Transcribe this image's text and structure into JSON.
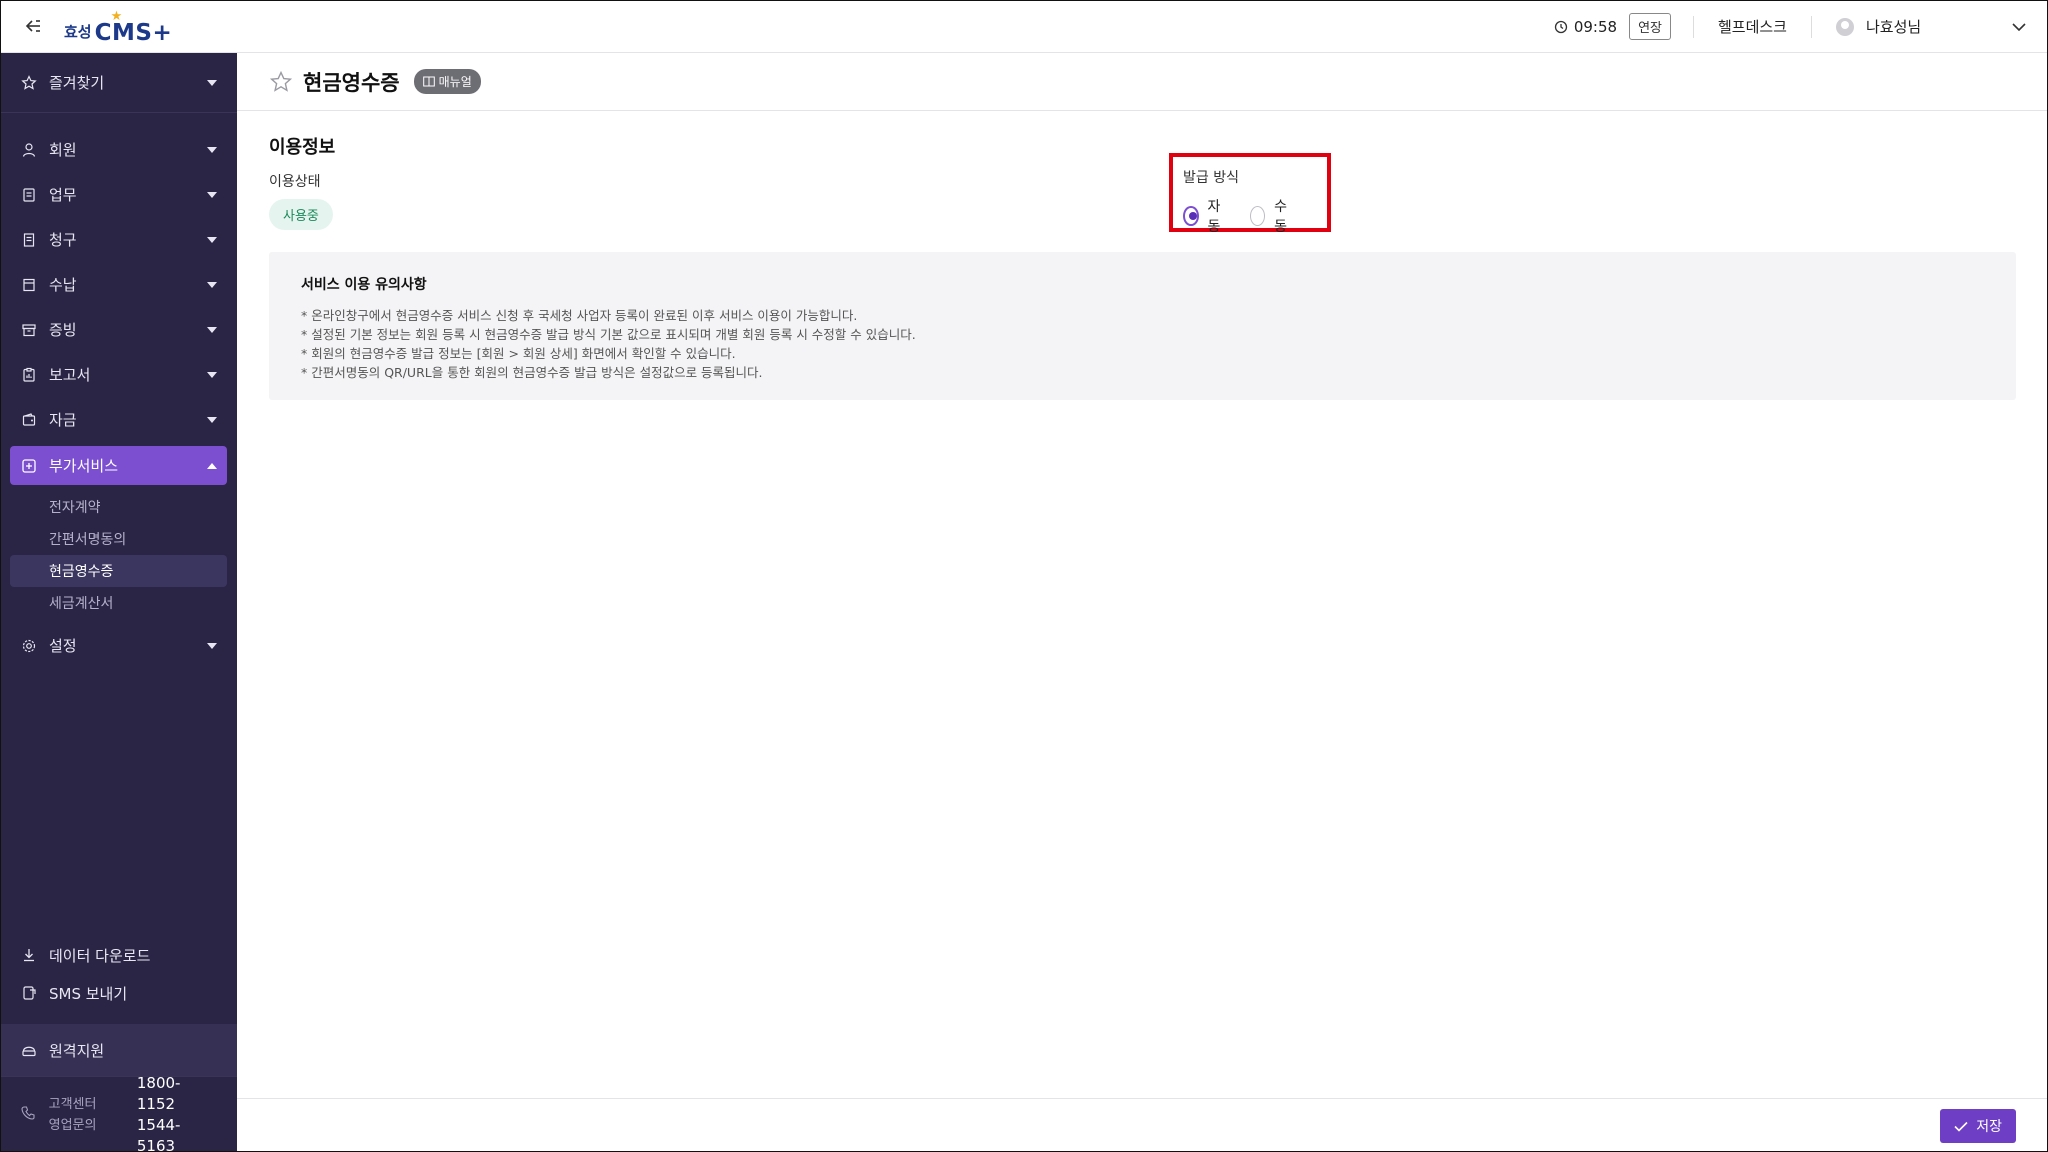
{
  "topbar": {
    "logo_prefix": "효성",
    "logo_main": "CMS+",
    "timer": "09:58",
    "extend_label": "연장",
    "helpdesk_label": "헬프데스크",
    "user_name": "나효성님"
  },
  "sidebar": {
    "favorites_label": "즐겨찾기",
    "menu": [
      {
        "label": "회원",
        "icon": "person-icon"
      },
      {
        "label": "업무",
        "icon": "task-icon"
      },
      {
        "label": "청구",
        "icon": "document-icon"
      },
      {
        "label": "수납",
        "icon": "receipt-icon"
      },
      {
        "label": "증빙",
        "icon": "archive-icon"
      },
      {
        "label": "보고서",
        "icon": "report-icon"
      },
      {
        "label": "자금",
        "icon": "wallet-icon"
      }
    ],
    "active_group": {
      "label": "부가서비스",
      "items": [
        "전자계약",
        "간편서명동의",
        "현금영수증",
        "세금계산서"
      ],
      "current_index": 2
    },
    "settings_label": "설정",
    "data_download_label": "데이터 다운로드",
    "sms_label": "SMS 보내기",
    "remote_label": "원격지원",
    "contact": {
      "center_label": "고객센터",
      "center_number": "1800-1152",
      "sales_label": "영업문의",
      "sales_number": "1544-5163"
    }
  },
  "main": {
    "page_title": "현금영수증",
    "manual_label": "매뉴얼",
    "section_title": "이용정보",
    "status_label": "이용상태",
    "status_value": "사용중",
    "issue_label": "발급 방식",
    "issue_options": [
      "자동",
      "수동"
    ],
    "issue_selected": "자동",
    "notice_title": "서비스 이용 유의사항",
    "notice_lines": [
      "* 온라인창구에서 현금영수증 서비스 신청 후 국세청 사업자 등록이 완료된 이후 서비스 이용이 가능합니다.",
      "* 설정된 기본 정보는 회원 등록 시 현금영수증 발급 방식 기본 값으로 표시되며 개별 회원 등록 시 수정할 수 있습니다.",
      "* 회원의 현금영수증 발급 정보는 [회원 > 회원 상세] 화면에서 확인할 수 있습니다.",
      "* 간편서명동의 QR/URL을 통한 회원의 현금영수증 발급 방식은 설정값으로 등록됩니다."
    ],
    "save_label": "저장"
  },
  "colors": {
    "sidebar_bg": "#2a2545",
    "accent": "#7b4fd0",
    "highlight_border": "#e00010",
    "status_green": "#1c8a5a"
  }
}
